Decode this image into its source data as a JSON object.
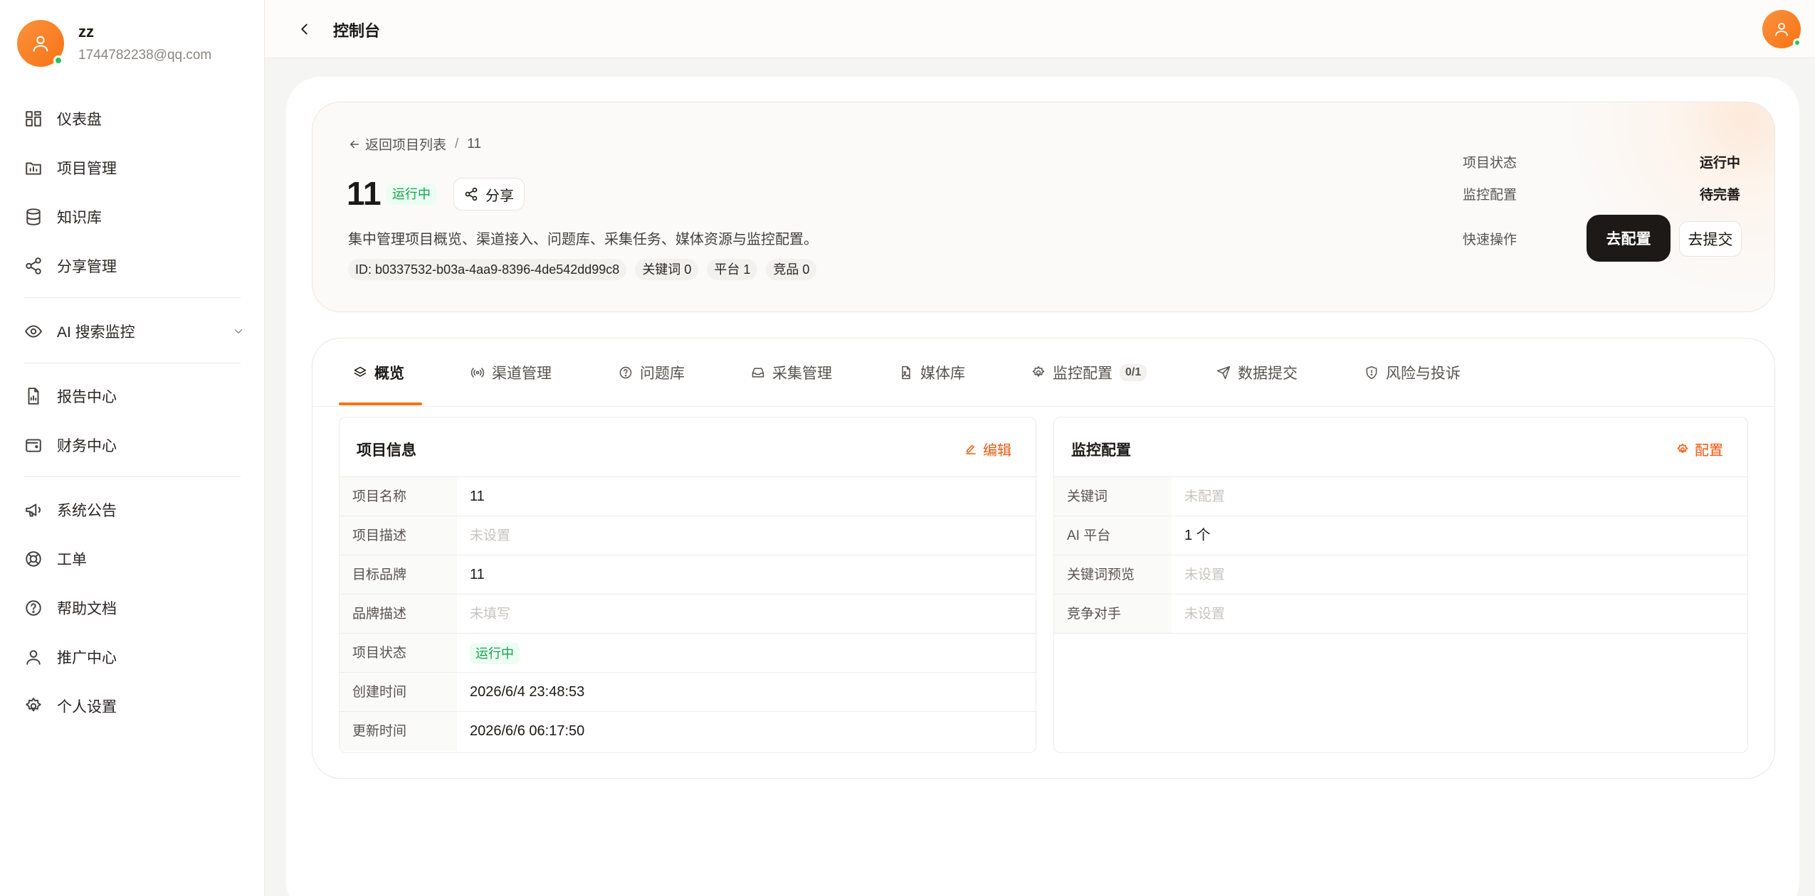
{
  "user": {
    "name": "zz",
    "email": "1744782238@qq.com"
  },
  "sidebar": {
    "items": [
      {
        "label": "仪表盘",
        "icon": "dashboard-icon"
      },
      {
        "label": "项目管理",
        "icon": "folder-icon"
      },
      {
        "label": "知识库",
        "icon": "database-icon"
      },
      {
        "label": "分享管理",
        "icon": "share-icon"
      },
      {
        "label": "AI 搜索监控",
        "icon": "eye-icon"
      },
      {
        "label": "报告中心",
        "icon": "report-icon"
      },
      {
        "label": "财务中心",
        "icon": "wallet-icon"
      },
      {
        "label": "系统公告",
        "icon": "megaphone-icon"
      },
      {
        "label": "工单",
        "icon": "lifebuoy-icon"
      },
      {
        "label": "帮助文档",
        "icon": "help-circle-icon"
      },
      {
        "label": "推广中心",
        "icon": "person-icon"
      },
      {
        "label": "个人设置",
        "icon": "gear-icon"
      }
    ]
  },
  "header": {
    "title": "控制台"
  },
  "hero": {
    "back_label": "返回项目列表",
    "breadcrumb_sep": "/",
    "breadcrumb_current": "11",
    "title": "11",
    "status": "运行中",
    "share_label": "分享",
    "description": "集中管理项目概览、渠道接入、问题库、采集任务、媒体资源与监控配置。",
    "chips": [
      "ID: b0337532-b03a-4aa9-8396-4de542dd99c8",
      "关键词 0",
      "平台 1",
      "竞品 0"
    ],
    "side": {
      "status_label": "项目状态",
      "status_value": "运行中",
      "monitor_label": "监控配置",
      "monitor_value": "待完善",
      "quick_label": "快速操作",
      "configure_button": "去配置",
      "submit_button": "去提交"
    }
  },
  "tabs": [
    {
      "label": "概览",
      "icon": "layers-icon",
      "active": true
    },
    {
      "label": "渠道管理",
      "icon": "broadcast-icon"
    },
    {
      "label": "问题库",
      "icon": "question-icon"
    },
    {
      "label": "采集管理",
      "icon": "inbox-icon"
    },
    {
      "label": "媒体库",
      "icon": "file-image-icon"
    },
    {
      "label": "监控配置",
      "icon": "gear-icon",
      "count": "0/1"
    },
    {
      "label": "数据提交",
      "icon": "send-icon"
    },
    {
      "label": "风险与投诉",
      "icon": "shield-icon"
    }
  ],
  "project_info": {
    "title": "项目信息",
    "action": "编辑",
    "rows": [
      {
        "label": "项目名称",
        "value": "11"
      },
      {
        "label": "项目描述",
        "value": "未设置",
        "empty": true
      },
      {
        "label": "目标品牌",
        "value": "11"
      },
      {
        "label": "品牌描述",
        "value": "未填写",
        "empty": true
      },
      {
        "label": "项目状态",
        "value": "运行中",
        "badge": true
      },
      {
        "label": "创建时间",
        "value": "2026/6/4 23:48:53"
      },
      {
        "label": "更新时间",
        "value": "2026/6/6 06:17:50"
      }
    ]
  },
  "monitor_config": {
    "title": "监控配置",
    "action": "配置",
    "rows": [
      {
        "label": "关键词",
        "value": "未配置",
        "empty": true
      },
      {
        "label": "AI 平台",
        "value": "1 个"
      },
      {
        "label": "关键词预览",
        "value": "未设置",
        "empty": true
      },
      {
        "label": "竞争对手",
        "value": "未设置",
        "empty": true
      }
    ]
  },
  "colors": {
    "accent": "#f97316",
    "success": "#16a34a",
    "dark": "#1c1917"
  }
}
